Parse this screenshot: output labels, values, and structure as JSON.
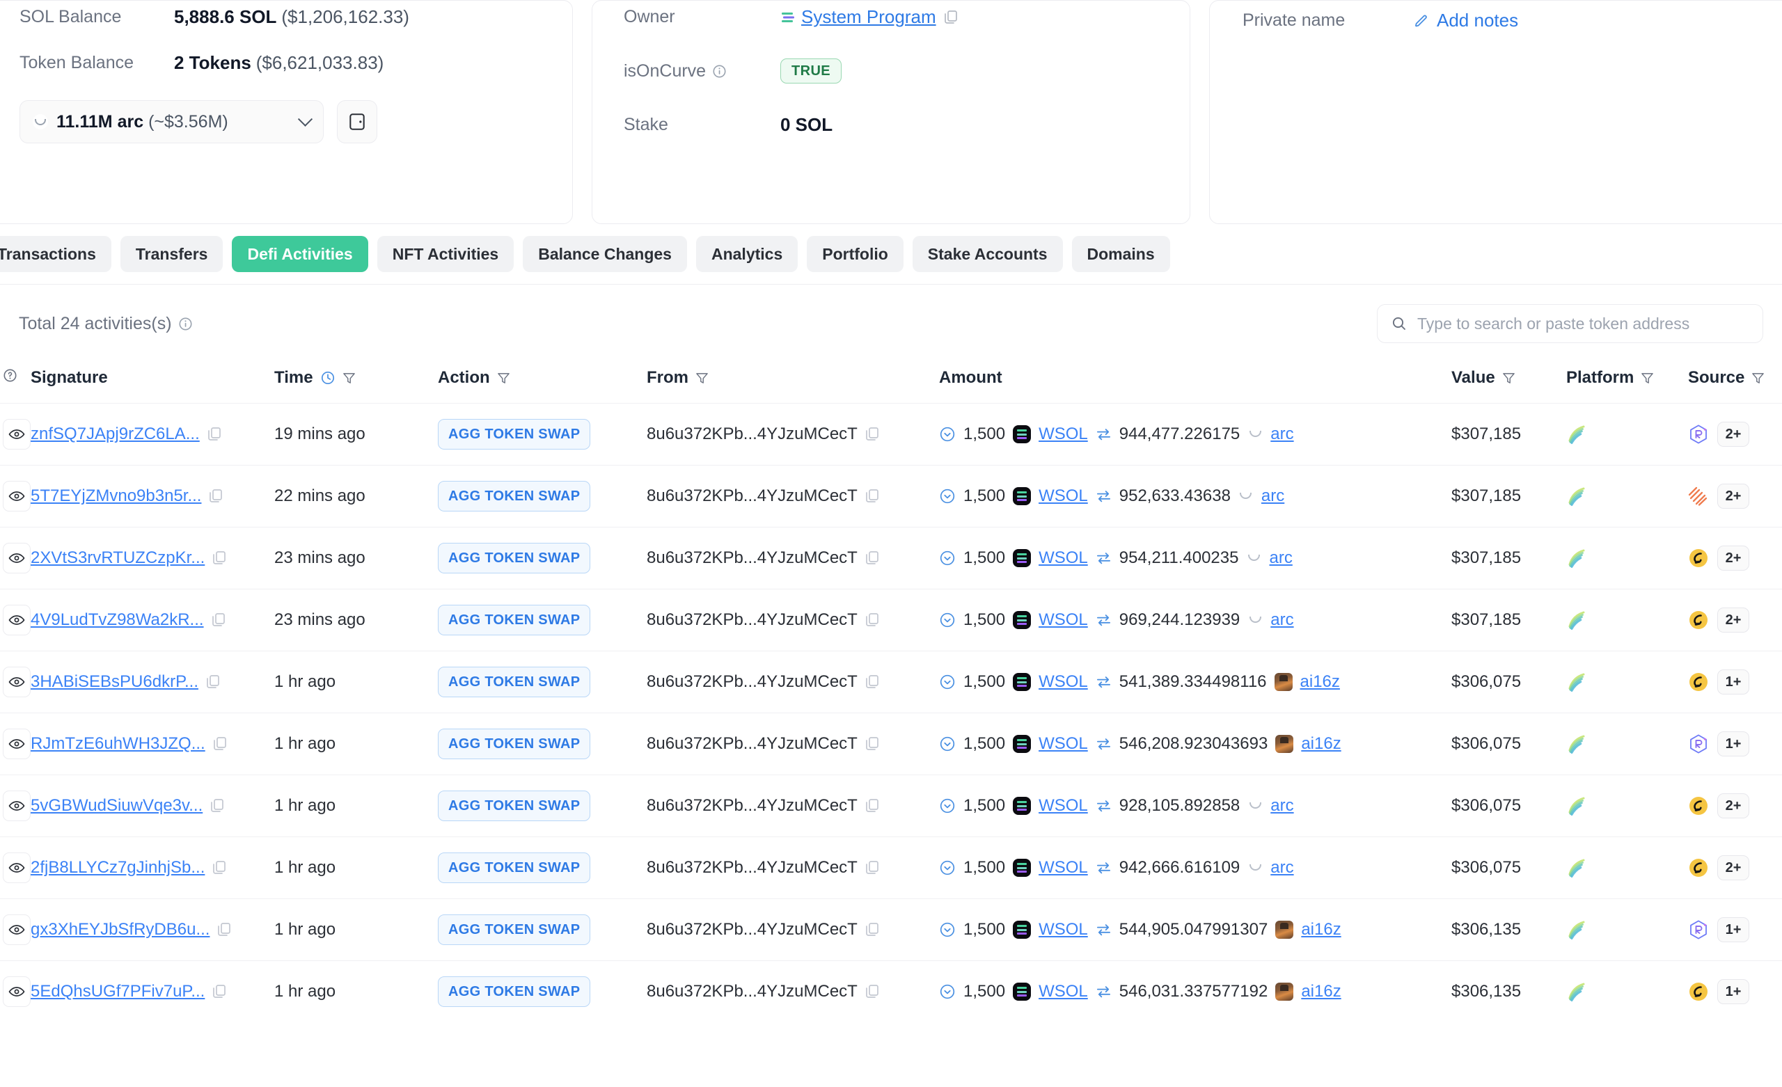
{
  "account": {
    "sol_balance_label": "SOL Balance",
    "sol_balance_value": "5,888.6 SOL",
    "sol_balance_usd": "($1,206,162.33)",
    "token_balance_label": "Token Balance",
    "token_balance_value": "2 Tokens",
    "token_balance_usd": "($6,621,033.83)",
    "token_select_amount": "11.11M arc",
    "token_select_usd": "(~$3.56M)",
    "owner_label": "Owner",
    "owner_value": "System Program",
    "is_on_curve_label": "isOnCurve",
    "is_on_curve_value": "TRUE",
    "stake_label": "Stake",
    "stake_value": "0 SOL",
    "private_name_label": "Private name",
    "add_notes_label": "Add notes"
  },
  "tabs": [
    {
      "label": "Transactions",
      "active": false
    },
    {
      "label": "Transfers",
      "active": false
    },
    {
      "label": "Defi Activities",
      "active": true
    },
    {
      "label": "NFT Activities",
      "active": false
    },
    {
      "label": "Balance Changes",
      "active": false
    },
    {
      "label": "Analytics",
      "active": false
    },
    {
      "label": "Portfolio",
      "active": false
    },
    {
      "label": "Stake Accounts",
      "active": false
    },
    {
      "label": "Domains",
      "active": false
    }
  ],
  "panel": {
    "total_text": "Total 24 activities(s)",
    "search_placeholder": "Type to search or paste token address"
  },
  "table": {
    "columns": [
      "Signature",
      "Time",
      "Action",
      "From",
      "Amount",
      "Value",
      "Platform",
      "Source"
    ],
    "rows": [
      {
        "signature": "znfSQ7JApj9rZC6LA...",
        "time": "19 mins ago",
        "action": "AGG TOKEN SWAP",
        "from": "8u6u372KPb...4YJzuMCecT",
        "amount_in": "1,500",
        "token_in": "WSOL",
        "amount_out": "944,477.226175",
        "token_out": "arc",
        "token_out_icon": "arc",
        "value": "$307,185",
        "platform": "jupiter",
        "source": "raydium",
        "source_count": "2+"
      },
      {
        "signature": "5T7EYjZMvno9b3n5r...",
        "time": "22 mins ago",
        "action": "AGG TOKEN SWAP",
        "from": "8u6u372KPb...4YJzuMCecT",
        "amount_in": "1,500",
        "token_in": "WSOL",
        "amount_out": "952,633.43638",
        "token_out": "arc",
        "token_out_icon": "arc",
        "value": "$307,185",
        "platform": "jupiter",
        "source": "orca",
        "source_count": "2+"
      },
      {
        "signature": "2XVtS3rvRTUZCzpKr...",
        "time": "23 mins ago",
        "action": "AGG TOKEN SWAP",
        "from": "8u6u372KPb...4YJzuMCecT",
        "amount_in": "1,500",
        "token_in": "WSOL",
        "amount_out": "954,211.400235",
        "token_out": "arc",
        "token_out_icon": "arc",
        "value": "$307,185",
        "platform": "jupiter",
        "source": "pumpfun",
        "source_count": "2+"
      },
      {
        "signature": "4V9LudTvZ98Wa2kR...",
        "time": "23 mins ago",
        "action": "AGG TOKEN SWAP",
        "from": "8u6u372KPb...4YJzuMCecT",
        "amount_in": "1,500",
        "token_in": "WSOL",
        "amount_out": "969,244.123939",
        "token_out": "arc",
        "token_out_icon": "arc",
        "value": "$307,185",
        "platform": "jupiter",
        "source": "pumpfun",
        "source_count": "2+"
      },
      {
        "signature": "3HABiSEBsPU6dkrP...",
        "time": "1 hr ago",
        "action": "AGG TOKEN SWAP",
        "from": "8u6u372KPb...4YJzuMCecT",
        "amount_in": "1,500",
        "token_in": "WSOL",
        "amount_out": "541,389.334498116",
        "token_out": "ai16z",
        "token_out_icon": "ai16z",
        "value": "$306,075",
        "platform": "jupiter",
        "source": "pumpfun",
        "source_count": "1+"
      },
      {
        "signature": "RJmTzE6uhWH3JZQ...",
        "time": "1 hr ago",
        "action": "AGG TOKEN SWAP",
        "from": "8u6u372KPb...4YJzuMCecT",
        "amount_in": "1,500",
        "token_in": "WSOL",
        "amount_out": "546,208.923043693",
        "token_out": "ai16z",
        "token_out_icon": "ai16z",
        "value": "$306,075",
        "platform": "jupiter",
        "source": "raydium",
        "source_count": "1+"
      },
      {
        "signature": "5vGBWudSiuwVqe3v...",
        "time": "1 hr ago",
        "action": "AGG TOKEN SWAP",
        "from": "8u6u372KPb...4YJzuMCecT",
        "amount_in": "1,500",
        "token_in": "WSOL",
        "amount_out": "928,105.892858",
        "token_out": "arc",
        "token_out_icon": "arc",
        "value": "$306,075",
        "platform": "jupiter",
        "source": "pumpfun",
        "source_count": "2+"
      },
      {
        "signature": "2fjB8LLYCz7gJinhjSb...",
        "time": "1 hr ago",
        "action": "AGG TOKEN SWAP",
        "from": "8u6u372KPb...4YJzuMCecT",
        "amount_in": "1,500",
        "token_in": "WSOL",
        "amount_out": "942,666.616109",
        "token_out": "arc",
        "token_out_icon": "arc",
        "value": "$306,075",
        "platform": "jupiter",
        "source": "pumpfun",
        "source_count": "2+"
      },
      {
        "signature": "gx3XhEYJbSfRyDB6u...",
        "time": "1 hr ago",
        "action": "AGG TOKEN SWAP",
        "from": "8u6u372KPb...4YJzuMCecT",
        "amount_in": "1,500",
        "token_in": "WSOL",
        "amount_out": "544,905.047991307",
        "token_out": "ai16z",
        "token_out_icon": "ai16z",
        "value": "$306,135",
        "platform": "jupiter",
        "source": "raydium",
        "source_count": "1+"
      },
      {
        "signature": "5EdQhsUGf7PFiv7uP...",
        "time": "1 hr ago",
        "action": "AGG TOKEN SWAP",
        "from": "8u6u372KPb...4YJzuMCecT",
        "amount_in": "1,500",
        "token_in": "WSOL",
        "amount_out": "546,031.337577192",
        "token_out": "ai16z",
        "token_out_icon": "ai16z",
        "value": "$306,135",
        "platform": "jupiter",
        "source": "pumpfun",
        "source_count": "1+"
      }
    ]
  },
  "colors": {
    "accent_green": "#3ec99a",
    "link_blue": "#3b82f6",
    "action_blue": "#2e7ae5",
    "true_green": "#1f7a46"
  }
}
